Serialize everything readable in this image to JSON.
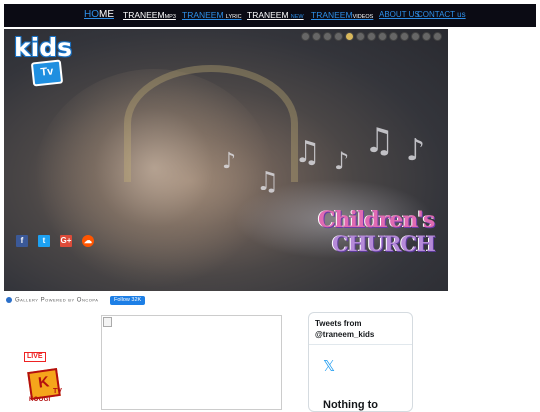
{
  "nav": {
    "home": {
      "part1": "HO",
      "part2": "ME"
    },
    "mp3": {
      "main": "TRANEEM",
      "suffix": "MP3"
    },
    "lyric": {
      "main": "TRANEEM",
      "suffix": "LYRIC"
    },
    "new": {
      "main": "TRANEEM",
      "suffix": "NEW"
    },
    "videos": {
      "main": "TRANEEM",
      "suffix": "VIDEOS"
    },
    "about": "ABOUT US",
    "contact": "CONTACT us"
  },
  "slider": {
    "logo_word": "kids",
    "logo_tv": "Tv",
    "slide_count": 13,
    "active_slide": 4,
    "church_line1": "Children's",
    "church_line2": "CHURCH",
    "social": [
      {
        "name": "facebook-icon",
        "glyph": "f",
        "color": "#3b5998"
      },
      {
        "name": "twitter-icon",
        "glyph": "t",
        "color": "#1da1f2"
      },
      {
        "name": "google-plus-icon",
        "glyph": "G+",
        "color": "#dd4b39"
      },
      {
        "name": "soundcloud-icon",
        "glyph": "☁",
        "color": "#ff5500"
      }
    ]
  },
  "gallery": {
    "caption": "Gallery Powered by Oncopa",
    "follow_label": "Follow 32K"
  },
  "sidebar": {
    "live_label": "LIVE",
    "koogi_logo_letter": "K",
    "koogi_tv": "TV",
    "koogi_name": "KOOGI"
  },
  "twitter": {
    "heading_line1": "Tweets from",
    "heading_line2": "@traneem_kids",
    "x_glyph": "𝕏",
    "empty_text": "Nothing to"
  }
}
